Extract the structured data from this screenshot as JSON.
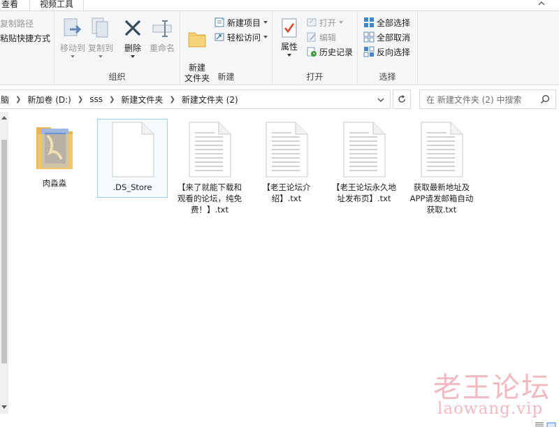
{
  "tabs": {
    "view": "查看",
    "video_tools": "视频工具"
  },
  "ribbon": {
    "clipboard": {
      "copy_path": "复制路径",
      "paste_shortcut": "粘贴快捷方式"
    },
    "organize": {
      "label": "组织",
      "move_to": "移动到",
      "copy_to": "复制到",
      "delete": "删除",
      "rename": "重命名"
    },
    "new": {
      "label": "新建",
      "new_folder": "新建\n文件夹",
      "new_item": "新建项目",
      "easy_access": "轻松访问"
    },
    "open": {
      "label": "打开",
      "properties": "属性",
      "open": "打开",
      "edit": "编辑",
      "history": "历史记录"
    },
    "select": {
      "label": "选择",
      "select_all": "全部选择",
      "select_none": "全部取消",
      "invert": "反向选择"
    }
  },
  "address": {
    "crumbs": [
      "脑",
      "新加卷 (D:)",
      "sss",
      "新建文件夹",
      "新建文件夹 (2)"
    ],
    "search_placeholder": "在 新建文件夹 (2) 中搜索"
  },
  "files": [
    {
      "name": "肉淼淼",
      "type": "folder"
    },
    {
      "name": ".DS_Store",
      "type": "file"
    },
    {
      "name": "【来了就能下载和观看的论坛，纯免费！】.txt",
      "type": "txt"
    },
    {
      "name": "【老王论坛介绍】.txt",
      "type": "txt"
    },
    {
      "name": "【老王论坛永久地址发布页】.txt",
      "type": "txt"
    },
    {
      "name": "获取最新地址及APP请发邮箱自动获取.txt",
      "type": "txt"
    }
  ],
  "watermark": {
    "cn": "老王论坛",
    "url": "laowang.vip"
  },
  "colors": {
    "accent": "#0078d7",
    "selection": "#99d1ff",
    "watermark": "#f3b9c0"
  }
}
